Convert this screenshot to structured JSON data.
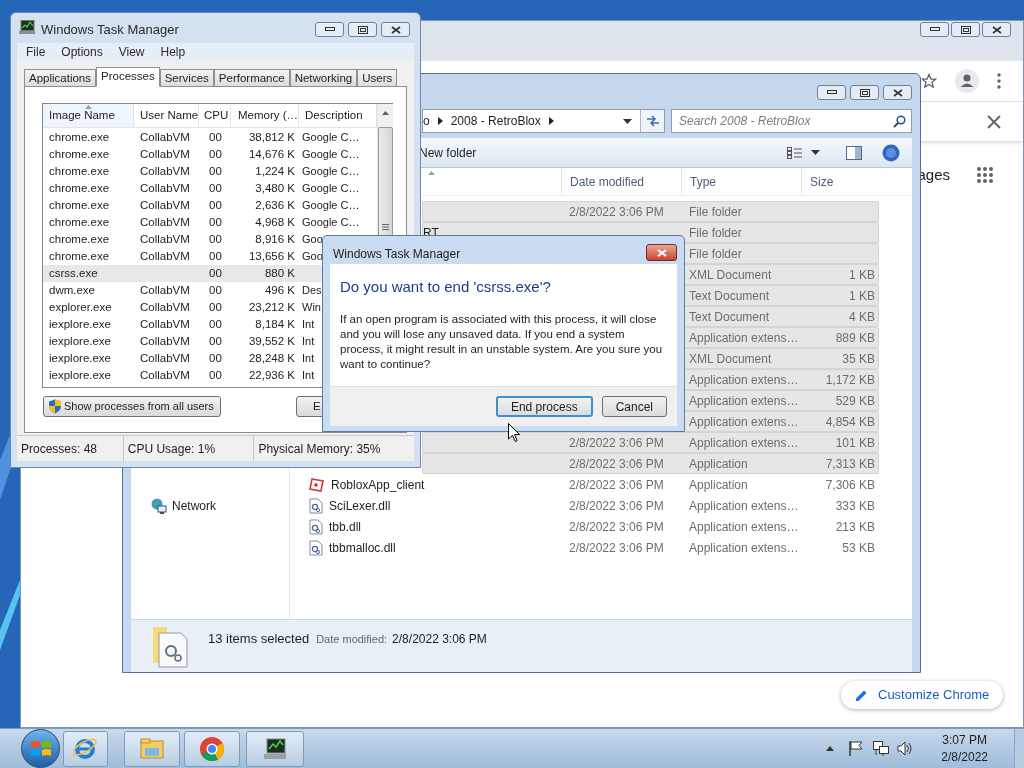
{
  "browser": {
    "partial_link": "ages",
    "customize_button": "Customize Chrome"
  },
  "explorer": {
    "breadcrumb": [
      "o",
      "2008 - RetroBlox"
    ],
    "search": {
      "placeholder": "Search 2008 - RetroBlox"
    },
    "new_folder": "New folder",
    "columns": [
      "Date modified",
      "Type",
      "Size"
    ],
    "navigation": [
      {
        "label": "Network"
      }
    ],
    "rows": [
      {
        "date": "2/8/2022 3:06 PM",
        "type": "File folder",
        "selected": true
      },
      {
        "name": "RT",
        "type": "File folder",
        "selected": true
      },
      {
        "type": "File folder",
        "selected": true
      },
      {
        "type": "XML Document",
        "size": "1 KB",
        "selected": true
      },
      {
        "type": "Text Document",
        "size": "1 KB",
        "selected": true
      },
      {
        "type": "Text Document",
        "size": "4 KB",
        "selected": true
      },
      {
        "type": "Application extens…",
        "size": "889 KB",
        "selected": true
      },
      {
        "type": "XML Document",
        "size": "35 KB",
        "selected": true
      },
      {
        "type": "Application extens…",
        "size": "1,172 KB",
        "selected": true
      },
      {
        "type": "Application extens…",
        "size": "529 KB",
        "selected": true
      },
      {
        "type": "Application extens…",
        "size": "4,854 KB",
        "selected": true
      },
      {
        "date": "2/8/2022 3:06 PM",
        "type": "Application extens…",
        "size": "101 KB",
        "selected": true
      },
      {
        "date": "2/8/2022 3:06 PM",
        "type": "Application",
        "size": "7,313 KB",
        "selected": true
      },
      {
        "name": "RobloxApp_client",
        "kind": "application",
        "date": "2/8/2022 3:06 PM",
        "type": "Application",
        "size": "7,306 KB",
        "selected": false
      },
      {
        "name": "SciLexer.dll",
        "kind": "dll",
        "date": "2/8/2022 3:06 PM",
        "type": "Application extens…",
        "size": "333 KB",
        "selected": false
      },
      {
        "name": "tbb.dll",
        "kind": "dll",
        "date": "2/8/2022 3:06 PM",
        "type": "Application extens…",
        "size": "213 KB",
        "selected": false
      },
      {
        "name": "tbbmalloc.dll",
        "kind": "dll",
        "date": "2/8/2022 3:06 PM",
        "type": "Application extens…",
        "size": "53 KB",
        "selected": false
      }
    ],
    "details": {
      "summary": "13 items selected",
      "label": "Date modified:",
      "value": "2/8/2022 3:06 PM"
    }
  },
  "task_manager": {
    "title": "Windows Task Manager",
    "menu": [
      "File",
      "Options",
      "View",
      "Help"
    ],
    "tabs": [
      {
        "label": "Applications",
        "selected": false
      },
      {
        "label": "Processes",
        "selected": true
      },
      {
        "label": "Services",
        "selected": false
      },
      {
        "label": "Performance",
        "selected": false
      },
      {
        "label": "Networking",
        "selected": false
      },
      {
        "label": "Users",
        "selected": false
      }
    ],
    "columns": [
      "Image Name",
      "User Name",
      "CPU",
      "Memory (…",
      "Description"
    ],
    "rows": [
      {
        "image": "chrome.exe",
        "user": "CollabVM",
        "cpu": "00",
        "memory": "38,812 K",
        "description": "Google C…",
        "selected": false
      },
      {
        "image": "chrome.exe",
        "user": "CollabVM",
        "cpu": "00",
        "memory": "14,676 K",
        "description": "Google C…",
        "selected": false
      },
      {
        "image": "chrome.exe",
        "user": "CollabVM",
        "cpu": "00",
        "memory": "1,224 K",
        "description": "Google C…",
        "selected": false
      },
      {
        "image": "chrome.exe",
        "user": "CollabVM",
        "cpu": "00",
        "memory": "3,480 K",
        "description": "Google C…",
        "selected": false
      },
      {
        "image": "chrome.exe",
        "user": "CollabVM",
        "cpu": "00",
        "memory": "2,636 K",
        "description": "Google C…",
        "selected": false
      },
      {
        "image": "chrome.exe",
        "user": "CollabVM",
        "cpu": "00",
        "memory": "4,968 K",
        "description": "Google C…",
        "selected": false
      },
      {
        "image": "chrome.exe",
        "user": "CollabVM",
        "cpu": "00",
        "memory": "8,916 K",
        "description": "Goo",
        "selected": false
      },
      {
        "image": "chrome.exe",
        "user": "CollabVM",
        "cpu": "00",
        "memory": "13,656 K",
        "description": "Goo",
        "selected": false
      },
      {
        "image": "csrss.exe",
        "cpu": "00",
        "memory": "880 K",
        "selected": true
      },
      {
        "image": "dwm.exe",
        "user": "CollabVM",
        "cpu": "00",
        "memory": "496 K",
        "description": "Des",
        "selected": false
      },
      {
        "image": "explorer.exe",
        "user": "CollabVM",
        "cpu": "00",
        "memory": "23,212 K",
        "description": "Win",
        "selected": false
      },
      {
        "image": "iexplore.exe",
        "user": "CollabVM",
        "cpu": "00",
        "memory": "8,184 K",
        "description": "Int",
        "selected": false
      },
      {
        "image": "iexplore.exe",
        "user": "CollabVM",
        "cpu": "00",
        "memory": "39,552 K",
        "description": "Int",
        "selected": false
      },
      {
        "image": "iexplore.exe",
        "user": "CollabVM",
        "cpu": "00",
        "memory": "28,248 K",
        "description": "Int",
        "selected": false
      },
      {
        "image": "iexplore.exe",
        "user": "CollabVM",
        "cpu": "00",
        "memory": "22,936 K",
        "description": "Int",
        "selected": false
      }
    ],
    "buttons": [
      {
        "label": "Show processes from all users",
        "kind": "shield"
      },
      {
        "label": "E",
        "kind": "plain"
      }
    ],
    "status": [
      "Processes: 48",
      "CPU Usage: 1%",
      "Physical Memory: 35%"
    ]
  },
  "dialog": {
    "title": "Windows Task Manager",
    "heading": "Do you want to end 'csrss.exe'?",
    "body": "If an open program is associated with this process, it will close and you will lose any unsaved data. If you end a system process, it might result in an unstable system. Are you sure you want to continue?",
    "buttons": [
      {
        "label": "End process",
        "focused": true
      },
      {
        "label": "Cancel",
        "focused": false
      }
    ]
  },
  "clock": {
    "time": "3:07 PM",
    "date": "2/8/2022"
  }
}
